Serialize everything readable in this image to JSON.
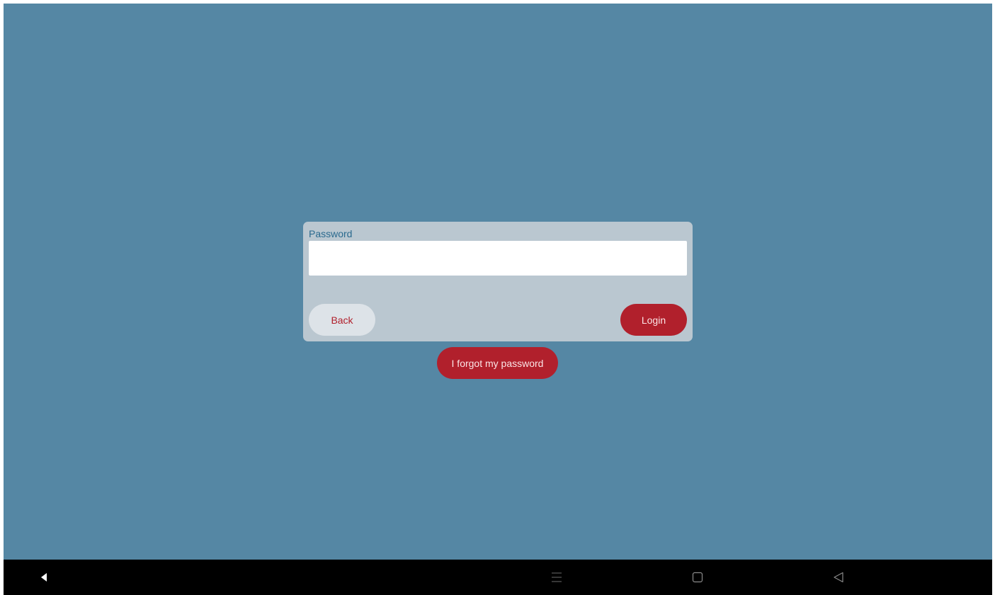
{
  "login": {
    "password_label": "Password",
    "password_value": "",
    "back_label": "Back",
    "login_label": "Login"
  },
  "forgot_label": "I forgot my password",
  "nav_bar": {
    "icons": [
      "arrow-left-icon",
      "menu-icon",
      "home-square-icon",
      "back-triangle-icon"
    ]
  },
  "colors": {
    "background": "#5587a4",
    "card": "#bac7d0",
    "label": "#2a6a8e",
    "accent": "#b1202c",
    "secondary_button": "#dde3e8",
    "nav_bar": "#000000"
  }
}
